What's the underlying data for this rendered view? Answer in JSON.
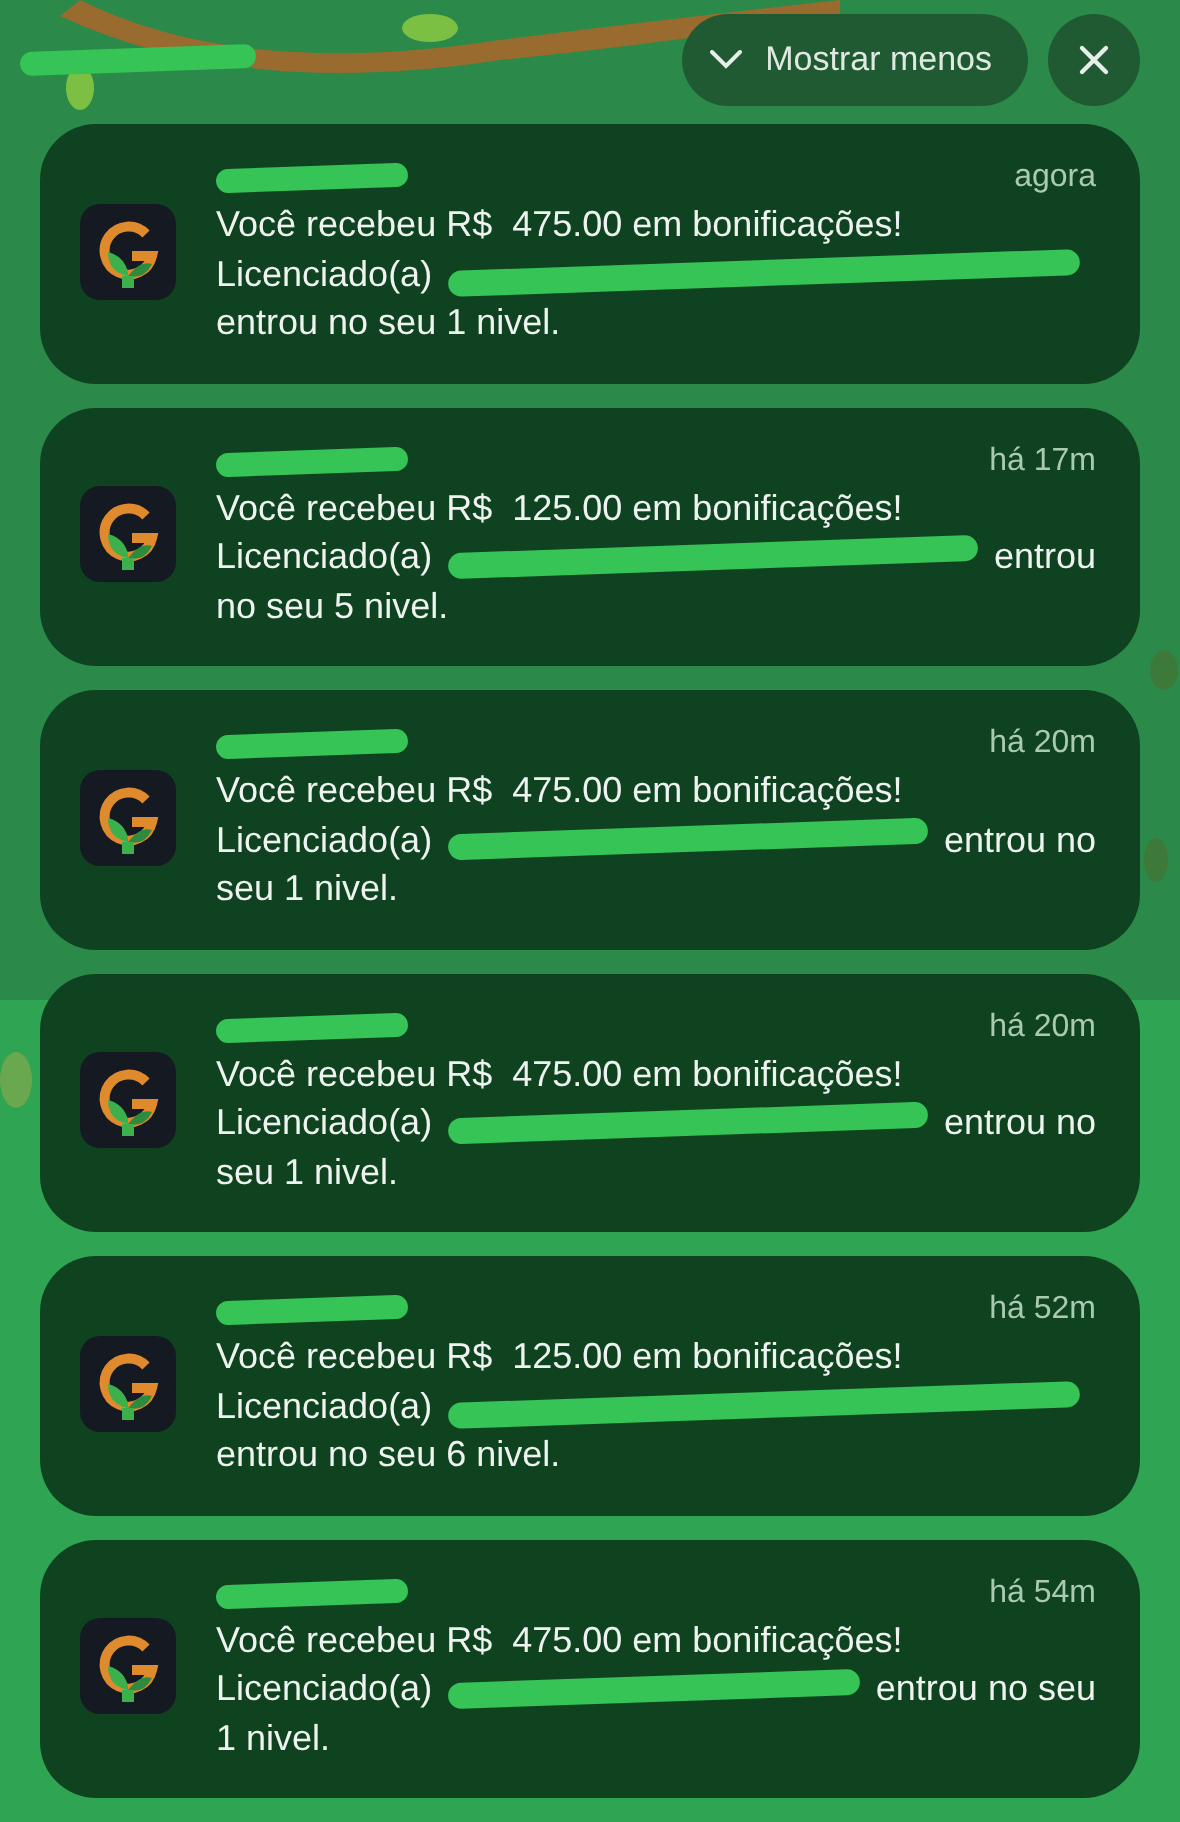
{
  "controls": {
    "collapse_label": "Mostrar menos"
  },
  "notifications": [
    {
      "time": "agora",
      "headline": "Você recebeu R$  475.00 em bonificações!",
      "prefix": "Licenciado(a)",
      "last_line": "entrou no seu 1 nivel."
    },
    {
      "time": "há 17m",
      "headline": "Você recebeu R$  125.00 em bonificações!",
      "prefix": "Licenciado(a)",
      "tail": "entrou",
      "last_line": "no seu 5 nivel."
    },
    {
      "time": "há 20m",
      "headline": "Você recebeu R$  475.00 em bonificações!",
      "prefix": "Licenciado(a)",
      "tail": "entrou no",
      "last_line": "seu 1 nivel."
    },
    {
      "time": "há 20m",
      "headline": "Você recebeu R$  475.00 em bonificações!",
      "prefix": "Licenciado(a)",
      "tail": "entrou no",
      "last_line": "seu 1 nivel."
    },
    {
      "time": "há 52m",
      "headline": "Você recebeu R$  125.00 em bonificações!",
      "prefix": "Licenciado(a)",
      "last_line": "entrou no seu 6 nivel."
    },
    {
      "time": "há 54m",
      "headline": "Você recebeu R$  475.00 em bonificações!",
      "prefix": "Licenciado(a)",
      "tail": "entrou no seu",
      "last_line": "1 nivel."
    }
  ]
}
